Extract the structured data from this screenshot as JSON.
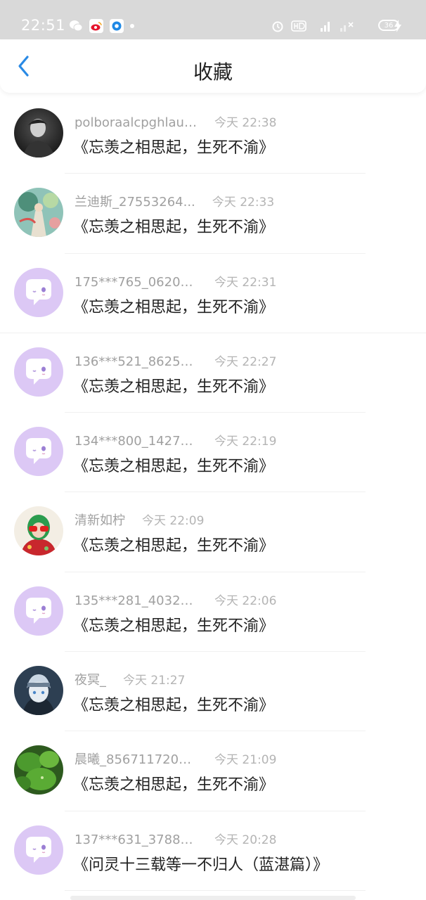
{
  "status_bar": {
    "time": "22:51",
    "battery": "36",
    "icons": [
      "wechat-icon",
      "weibo-icon",
      "app-icon",
      "alarm-icon",
      "hd-icon",
      "signal-4g-icon",
      "signal-icon",
      "battery-icon",
      "charging-icon"
    ]
  },
  "header": {
    "title": "收藏",
    "back_icon": "chevron-left-icon",
    "accent": "#2a8ae5"
  },
  "items": [
    {
      "username": "polboraalcpghlauren",
      "time": "今天 22:38",
      "story": "《忘羡之相思起，生死不渝》",
      "avatar": "photo-dark"
    },
    {
      "username": "兰迪斯_27553264...",
      "time": "今天 22:33",
      "story": "《忘羡之相思起，生死不渝》",
      "avatar": "photo-art"
    },
    {
      "username": "175***765_06209...",
      "time": "今天 22:31",
      "story": "《忘羡之相思起，生死不渝》",
      "avatar": "default"
    },
    {
      "username": "136***521_86250...",
      "time": "今天 22:27",
      "story": "《忘羡之相思起，生死不渝》",
      "avatar": "default"
    },
    {
      "username": "134***800_14278...",
      "time": "今天 22:19",
      "story": "《忘羡之相思起，生死不渝》",
      "avatar": "default"
    },
    {
      "username": "清新如柠",
      "time": "今天 22:09",
      "story": "《忘羡之相思起，生死不渝》",
      "avatar": "photo-red"
    },
    {
      "username": "135***281_40324...",
      "time": "今天 22:06",
      "story": "《忘羡之相思起，生死不渝》",
      "avatar": "default"
    },
    {
      "username": "夜冥_",
      "time": "今天 21:27",
      "story": "《忘羡之相思起，生死不渝》",
      "avatar": "photo-anime"
    },
    {
      "username": "晨曦_8567117204...",
      "time": "今天 21:09",
      "story": "《忘羡之相思起，生死不渝》",
      "avatar": "photo-leaf"
    },
    {
      "username": "137***631_37888...",
      "time": "今天 20:28",
      "story": "《问灵十三载等一不归人（蓝湛篇）》",
      "avatar": "default"
    }
  ],
  "colors": {
    "default_avatar": "#dcc8f5",
    "username": "#a0a0a0",
    "time": "#b4b4b4"
  }
}
